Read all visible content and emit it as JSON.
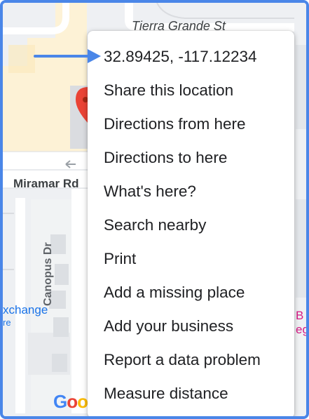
{
  "map": {
    "streets": {
      "tierra_grande": "Tierra Grande St",
      "miramar": "Miramar Rd",
      "canopus": "Canopus Dr"
    },
    "pois": {
      "left_label_line1": "xchange",
      "left_label_line2": "re",
      "right_label_line1": "B",
      "right_label_line2": "ego"
    },
    "attribution": [
      "G",
      "o",
      "o"
    ],
    "colors": {
      "road": "#ffffff",
      "land": "#eef0f3",
      "building": "#e3e6ea",
      "highlight": "#fdf2d6",
      "pin": "#ea4335",
      "poi_blue": "#1a73e8",
      "poi_pink": "#d81b85"
    }
  },
  "annotation": {
    "arrow_color": "#4a86e8"
  },
  "context_menu": {
    "items": [
      {
        "label": "32.89425, -117.12234",
        "name": "menu-item-coordinates"
      },
      {
        "label": "Share this location",
        "name": "menu-item-share-location"
      },
      {
        "label": "Directions from here",
        "name": "menu-item-directions-from"
      },
      {
        "label": "Directions to here",
        "name": "menu-item-directions-to"
      },
      {
        "label": "What's here?",
        "name": "menu-item-whats-here"
      },
      {
        "label": "Search nearby",
        "name": "menu-item-search-nearby"
      },
      {
        "label": "Print",
        "name": "menu-item-print"
      },
      {
        "label": "Add a missing place",
        "name": "menu-item-add-missing-place"
      },
      {
        "label": "Add your business",
        "name": "menu-item-add-business"
      },
      {
        "label": "Report a data problem",
        "name": "menu-item-report-data-problem"
      },
      {
        "label": "Measure distance",
        "name": "menu-item-measure-distance"
      }
    ]
  }
}
